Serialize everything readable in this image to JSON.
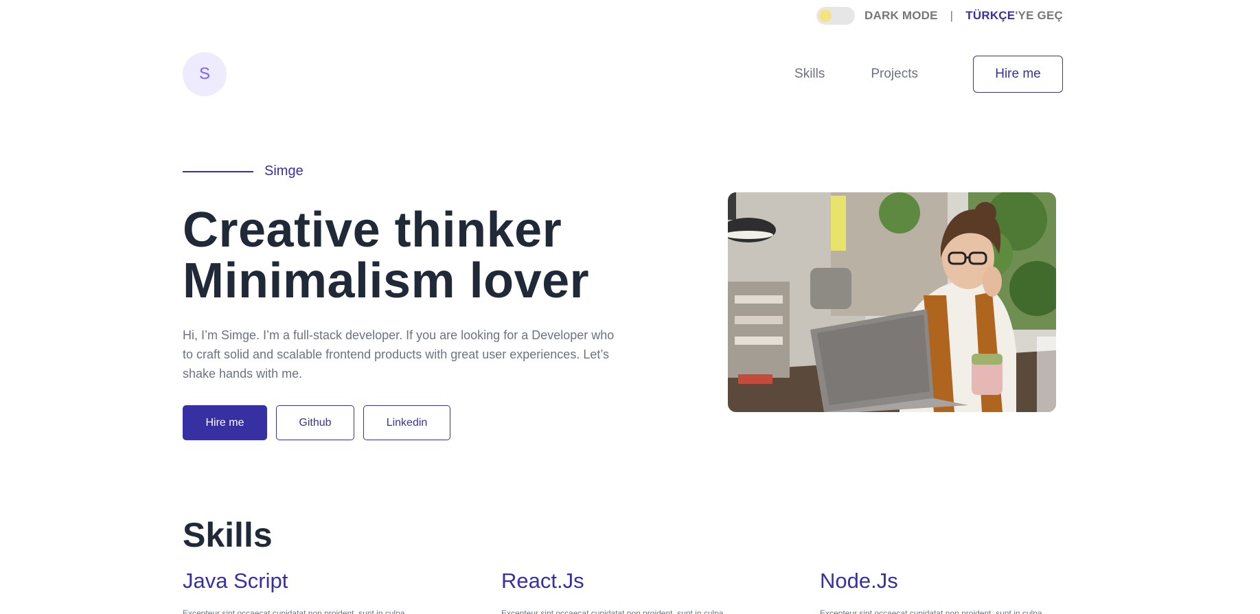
{
  "topbar": {
    "dark_mode_label": "DARK MODE",
    "separator": "|",
    "lang_accent": "TÜRKÇE",
    "lang_rest": "'YE GEÇ"
  },
  "header": {
    "logo_letter": "S",
    "nav": [
      "Skills",
      "Projects"
    ],
    "hire_label": "Hire me"
  },
  "hero": {
    "eyebrow": "Simge",
    "headline_line1": "Creative thinker",
    "headline_line2": "Minimalism lover",
    "intro": "Hi, I’m Simge. I’m a full-stack developer. If you are looking for a Developer who to craft solid and scalable frontend products with great user experiences. Let’s shake hands with me.",
    "buttons": {
      "hire": "Hire me",
      "github": "Github",
      "linkedin": "Linkedin"
    }
  },
  "skills": {
    "title": "Skills",
    "items": [
      {
        "name": "Java Script",
        "desc": "Excepteur sint occaecat cupidatat non proident, sunt in culpa"
      },
      {
        "name": "React.Js",
        "desc": "Excepteur sint occaecat cupidatat non proident, sunt in culpa"
      },
      {
        "name": "Node.Js",
        "desc": "Excepteur sint occaecat cupidatat non proident, sunt in culpa"
      }
    ]
  },
  "colors": {
    "accent": "#3730a3",
    "heading": "#1f2937",
    "muted": "#6b7280",
    "logo_bg": "#eeebff",
    "toggle_knob": "#f6e27f"
  }
}
